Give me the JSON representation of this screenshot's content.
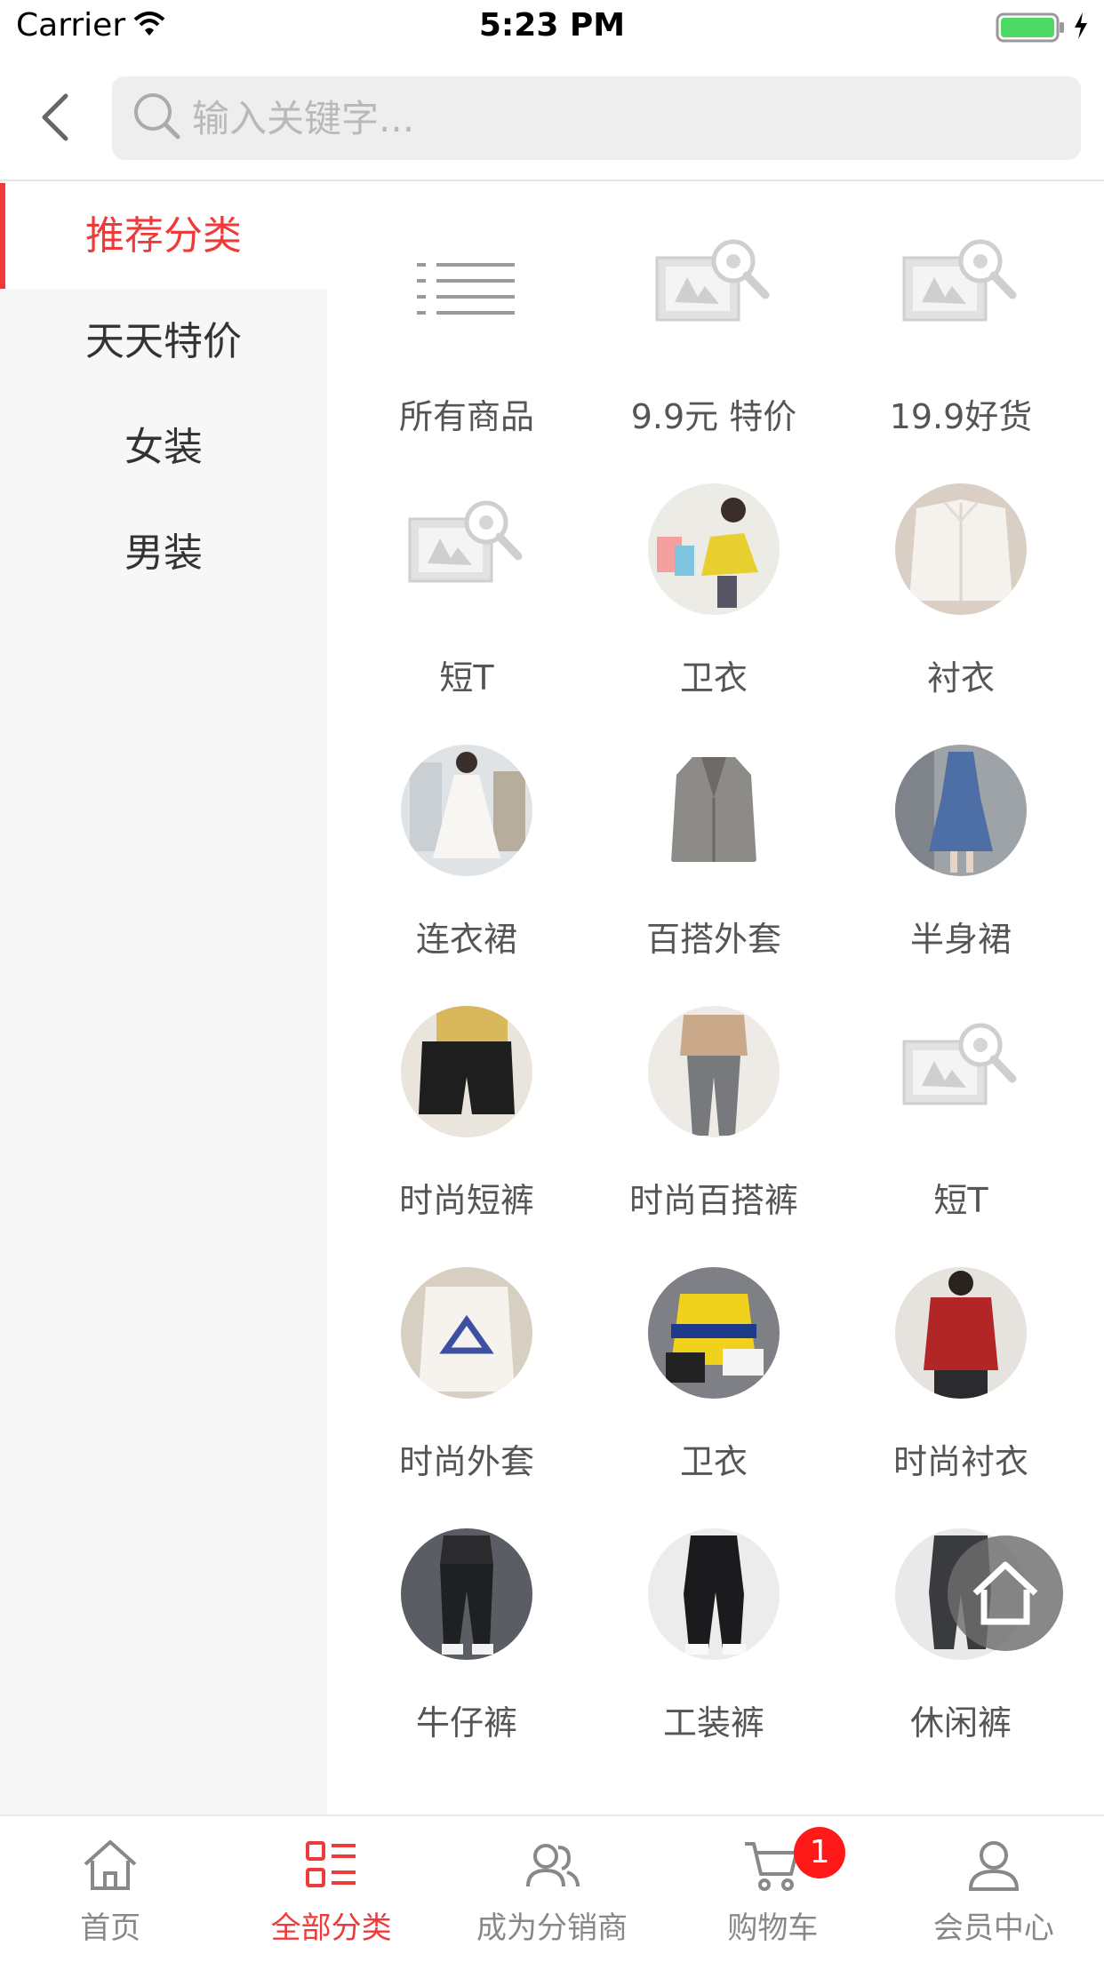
{
  "status_bar": {
    "carrier": "Carrier",
    "time": "5:23 PM"
  },
  "search": {
    "placeholder": "输入关键字..."
  },
  "sidebar": {
    "items": [
      {
        "label": "推荐分类",
        "active": true
      },
      {
        "label": "天天特价",
        "active": false
      },
      {
        "label": "女装",
        "active": false
      },
      {
        "label": "男装",
        "active": false
      }
    ]
  },
  "grid": {
    "items": [
      {
        "label": "所有商品",
        "icon": "list-icon"
      },
      {
        "label": "9.9元 特价",
        "icon": "image-placeholder-icon"
      },
      {
        "label": "19.9好货",
        "icon": "image-placeholder-icon"
      },
      {
        "label": "短T",
        "icon": "image-placeholder-icon"
      },
      {
        "label": "卫衣",
        "icon": "hoodie-photo"
      },
      {
        "label": "衬衣",
        "icon": "shirt-photo"
      },
      {
        "label": "连衣裙",
        "icon": "dress-photo"
      },
      {
        "label": "百搭外套",
        "icon": "coat-photo"
      },
      {
        "label": "半身裙",
        "icon": "skirt-photo"
      },
      {
        "label": "时尚短裤",
        "icon": "shorts-photo"
      },
      {
        "label": "时尚百搭裤",
        "icon": "pants-photo"
      },
      {
        "label": "短T",
        "icon": "image-placeholder-icon"
      },
      {
        "label": "时尚外套",
        "icon": "jacket-photo"
      },
      {
        "label": "卫衣",
        "icon": "yellow-hoodie-photo"
      },
      {
        "label": "时尚衬衣",
        "icon": "red-shirt-photo"
      },
      {
        "label": "牛仔裤",
        "icon": "jeans-photo"
      },
      {
        "label": "工装裤",
        "icon": "cargo-pants-photo"
      },
      {
        "label": "休闲裤",
        "icon": "casual-pants-photo"
      }
    ]
  },
  "tab_bar": {
    "tabs": [
      {
        "label": "首页",
        "icon": "home-icon",
        "active": false
      },
      {
        "label": "全部分类",
        "icon": "category-icon",
        "active": true
      },
      {
        "label": "成为分销商",
        "icon": "users-icon",
        "active": false
      },
      {
        "label": "购物车",
        "icon": "cart-icon",
        "active": false
      },
      {
        "label": "会员中心",
        "icon": "user-icon",
        "active": false
      }
    ],
    "cart_badge": "1"
  },
  "colors": {
    "accent": "#ef3a3a",
    "badge": "#ff1a1a",
    "sidebar_bg": "#f7f7f7"
  }
}
